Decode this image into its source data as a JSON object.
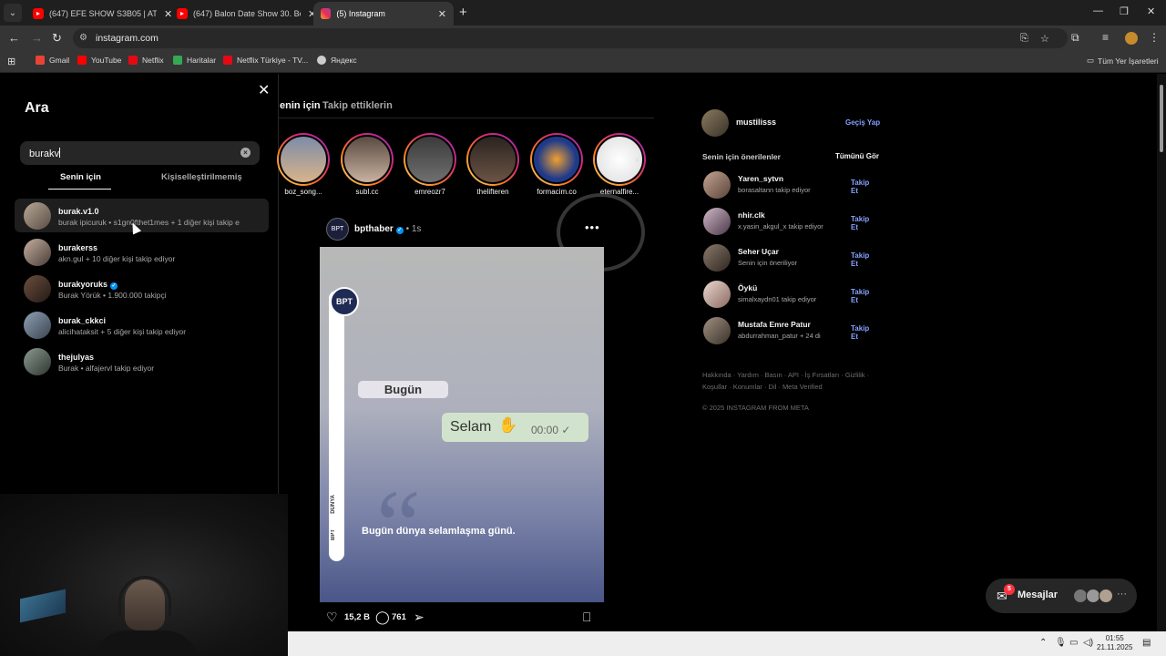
{
  "browser": {
    "tabs": [
      {
        "title": "(647) EFE SHOW S3B05 | ATİ242",
        "favicon": "youtube-icon",
        "active": false
      },
      {
        "title": "(647) Balon Date Show 30. Bölü",
        "favicon": "youtube-icon",
        "active": false
      },
      {
        "title": "(5) Instagram",
        "favicon": "instagram-icon",
        "active": true
      }
    ],
    "url": "instagram.com",
    "bookmarks": [
      {
        "label": "Gmail",
        "color": "#ea4335"
      },
      {
        "label": "YouTube",
        "color": "#ff0000"
      },
      {
        "label": "Netflix",
        "color": "#e50914"
      },
      {
        "label": "Haritalar",
        "color": "#34a853"
      },
      {
        "label": "Netflix Türkiye - TV...",
        "color": "#e50914"
      },
      {
        "label": "Яндекс",
        "color": "#cccccc"
      }
    ],
    "all_bookmarks": "Tüm Yer İşaretleri"
  },
  "search": {
    "title": "Ara",
    "query": "burakv",
    "tabs": [
      "Senin için",
      "Kişiselleştirilmemiş"
    ],
    "results": [
      {
        "username": "burak.v1.0",
        "verified": false,
        "sub": "burak ipicuruk • s1gn0fthet1mes + 1 diğer kişi takip e"
      },
      {
        "username": "burakerss",
        "verified": false,
        "sub": "akn.gul + 10 diğer kişi takip ediyor"
      },
      {
        "username": "burakyoruks",
        "verified": true,
        "sub": "Burak Yörük • 1.900.000 takipçi"
      },
      {
        "username": "burak_ckkci",
        "verified": false,
        "sub": "alicihataksit + 5 diğer kişi takip ediyor"
      },
      {
        "username": "thejulyas",
        "verified": false,
        "sub": "Burak • alfajervl takip ediyor"
      }
    ]
  },
  "feed": {
    "tab_foryou": "enin için",
    "tab_following": "Takip ettiklerin",
    "stories": [
      "boz_song...",
      "subl.cc",
      "emreozr7",
      "thelifteren",
      "formacim.co",
      "eternalfire..."
    ],
    "post": {
      "author": "bpthaber",
      "time": "1s",
      "logo_text": "BPT",
      "side_text_1": "DÜNYA",
      "side_text_2": "BPT",
      "today_label": "Bugün",
      "message": "Selam",
      "message_time": "00:00 ✓",
      "caption": "Bugün dünya selamlaşma günü.",
      "likes": "15,2 B",
      "comments": "761"
    }
  },
  "sidebar": {
    "me": "mustilisss",
    "switch": "Geçiş Yap",
    "heading": "Senin için önerilenler",
    "see_all": "Tümünü Gör",
    "follow_label": "Takip Et",
    "suggestions": [
      {
        "name": "Yaren_sytvn",
        "sub": "borasaltann takip ediyor"
      },
      {
        "name": "nhir.clk",
        "sub": "x.yasin_akgul_x takip ediyor"
      },
      {
        "name": "Seher Uçar",
        "sub": "Senin için öneriliyor"
      },
      {
        "name": "Öykü",
        "sub": "simalxaydn01 takip ediyor"
      },
      {
        "name": "Mustafa Emre Patur",
        "sub": "abdurrahman_patur + 24 di"
      }
    ],
    "footer": "Hakkında · Yardım · Basın · API · İş Fırsatları · Gizlilik · Koşullar · Konumlar · Dil · Meta Verified",
    "copyright": "© 2025 INSTAGRAM FROM META"
  },
  "messages": {
    "label": "Mesajlar",
    "badge": "5"
  },
  "taskbar": {
    "time": "01:55",
    "date": "21.11.2025"
  }
}
